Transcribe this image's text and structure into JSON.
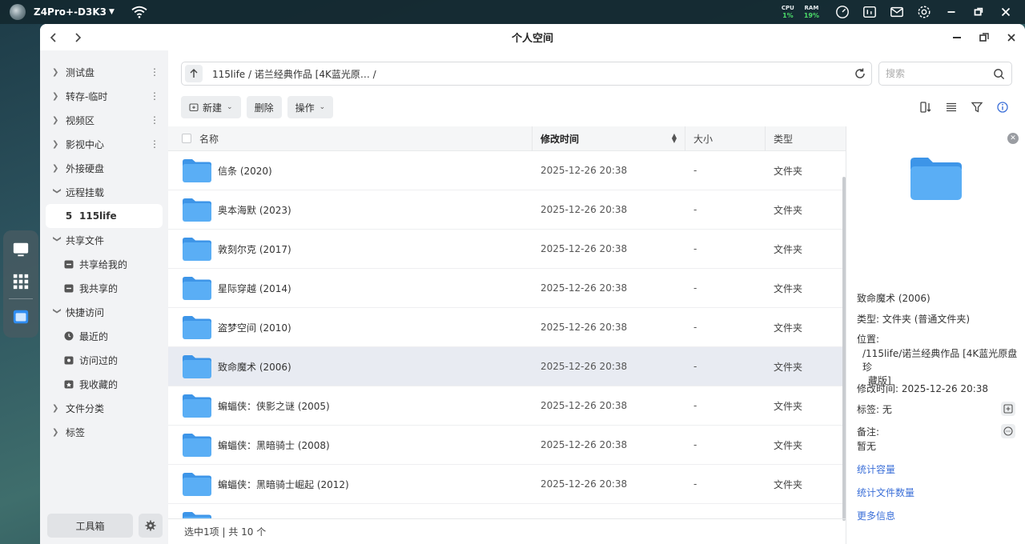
{
  "system_bar": {
    "device_name": "Z4Pro+-D3K3",
    "cpu_label": "CPU",
    "cpu_value": "1%",
    "ram_label": "RAM",
    "ram_value": "19%",
    "icons": [
      "speedometer-icon",
      "task-manager-icon",
      "mail-icon",
      "settings-icon",
      "minimize-icon",
      "restore-icon",
      "close-icon"
    ]
  },
  "window": {
    "title": "个人空间"
  },
  "sidebar": {
    "items": [
      {
        "label": "测试盘",
        "has_more": true
      },
      {
        "label": "转存-临时",
        "has_more": true
      },
      {
        "label": "视频区",
        "has_more": true
      },
      {
        "label": "影视中心",
        "has_more": true
      },
      {
        "label": "外接硬盘",
        "has_more": false
      },
      {
        "label": "远程挂载",
        "expanded": true
      },
      {
        "label": "115life",
        "active": true
      },
      {
        "label": "共享文件",
        "expanded": true
      },
      {
        "label": "共享给我的"
      },
      {
        "label": "我共享的"
      },
      {
        "label": "快捷访问",
        "expanded": true
      },
      {
        "label": "最近的"
      },
      {
        "label": "访问过的"
      },
      {
        "label": "我收藏的"
      },
      {
        "label": "文件分类"
      },
      {
        "label": "标签"
      }
    ],
    "toolbox_label": "工具箱"
  },
  "pathbar": {
    "path": "115life / 诺兰经典作品 [4K蓝光原… /"
  },
  "search": {
    "placeholder": "搜索"
  },
  "actions": {
    "new_label": "新建",
    "delete_label": "删除",
    "operate_label": "操作"
  },
  "table": {
    "headers": {
      "name": "名称",
      "time": "修改时间",
      "size": "大小",
      "type": "类型"
    },
    "rows": [
      {
        "name": "信条 (2020)",
        "time": "2025-12-26 20:38",
        "size": "-",
        "type": "文件夹"
      },
      {
        "name": "奥本海默 (2023)",
        "time": "2025-12-26 20:38",
        "size": "-",
        "type": "文件夹"
      },
      {
        "name": "敦刻尔克 (2017)",
        "time": "2025-12-26 20:38",
        "size": "-",
        "type": "文件夹"
      },
      {
        "name": "星际穿越 (2014)",
        "time": "2025-12-26 20:38",
        "size": "-",
        "type": "文件夹"
      },
      {
        "name": "盗梦空间 (2010)",
        "time": "2025-12-26 20:38",
        "size": "-",
        "type": "文件夹"
      },
      {
        "name": "致命魔术 (2006)",
        "time": "2025-12-26 20:38",
        "size": "-",
        "type": "文件夹",
        "selected": true
      },
      {
        "name": "蝙蝠侠：侠影之谜 (2005)",
        "time": "2025-12-26 20:38",
        "size": "-",
        "type": "文件夹"
      },
      {
        "name": "蝙蝠侠：黑暗骑士 (2008)",
        "time": "2025-12-26 20:38",
        "size": "-",
        "type": "文件夹"
      },
      {
        "name": "蝙蝠侠：黑暗骑士崛起 (2012)",
        "time": "2025-12-26 20:38",
        "size": "-",
        "type": "文件夹"
      }
    ]
  },
  "status": {
    "text": "选中1项 | 共 10 个"
  },
  "detail": {
    "name": "致命魔术 (2006)",
    "type_label": "类型:",
    "type_value": "文件夹 (普通文件夹)",
    "location_label": "位置:",
    "location_value_line1": "/115life/诺兰经典作品 [4K蓝光原盘珍",
    "location_value_line2": "藏版]",
    "modified_label": "修改时间:",
    "modified_value": "2025-12-26 20:38",
    "tag_label": "标签:",
    "tag_value": "无",
    "note_label": "备注:",
    "note_value": "暂无",
    "link_capacity": "统计容量",
    "link_count": "统计文件数量",
    "link_more": "更多信息"
  },
  "colors": {
    "accent": "#3b6fd8",
    "folder": "#5aaef5",
    "cpu_ok": "#4cdc6a",
    "selected_row": "#e8ebf2"
  }
}
